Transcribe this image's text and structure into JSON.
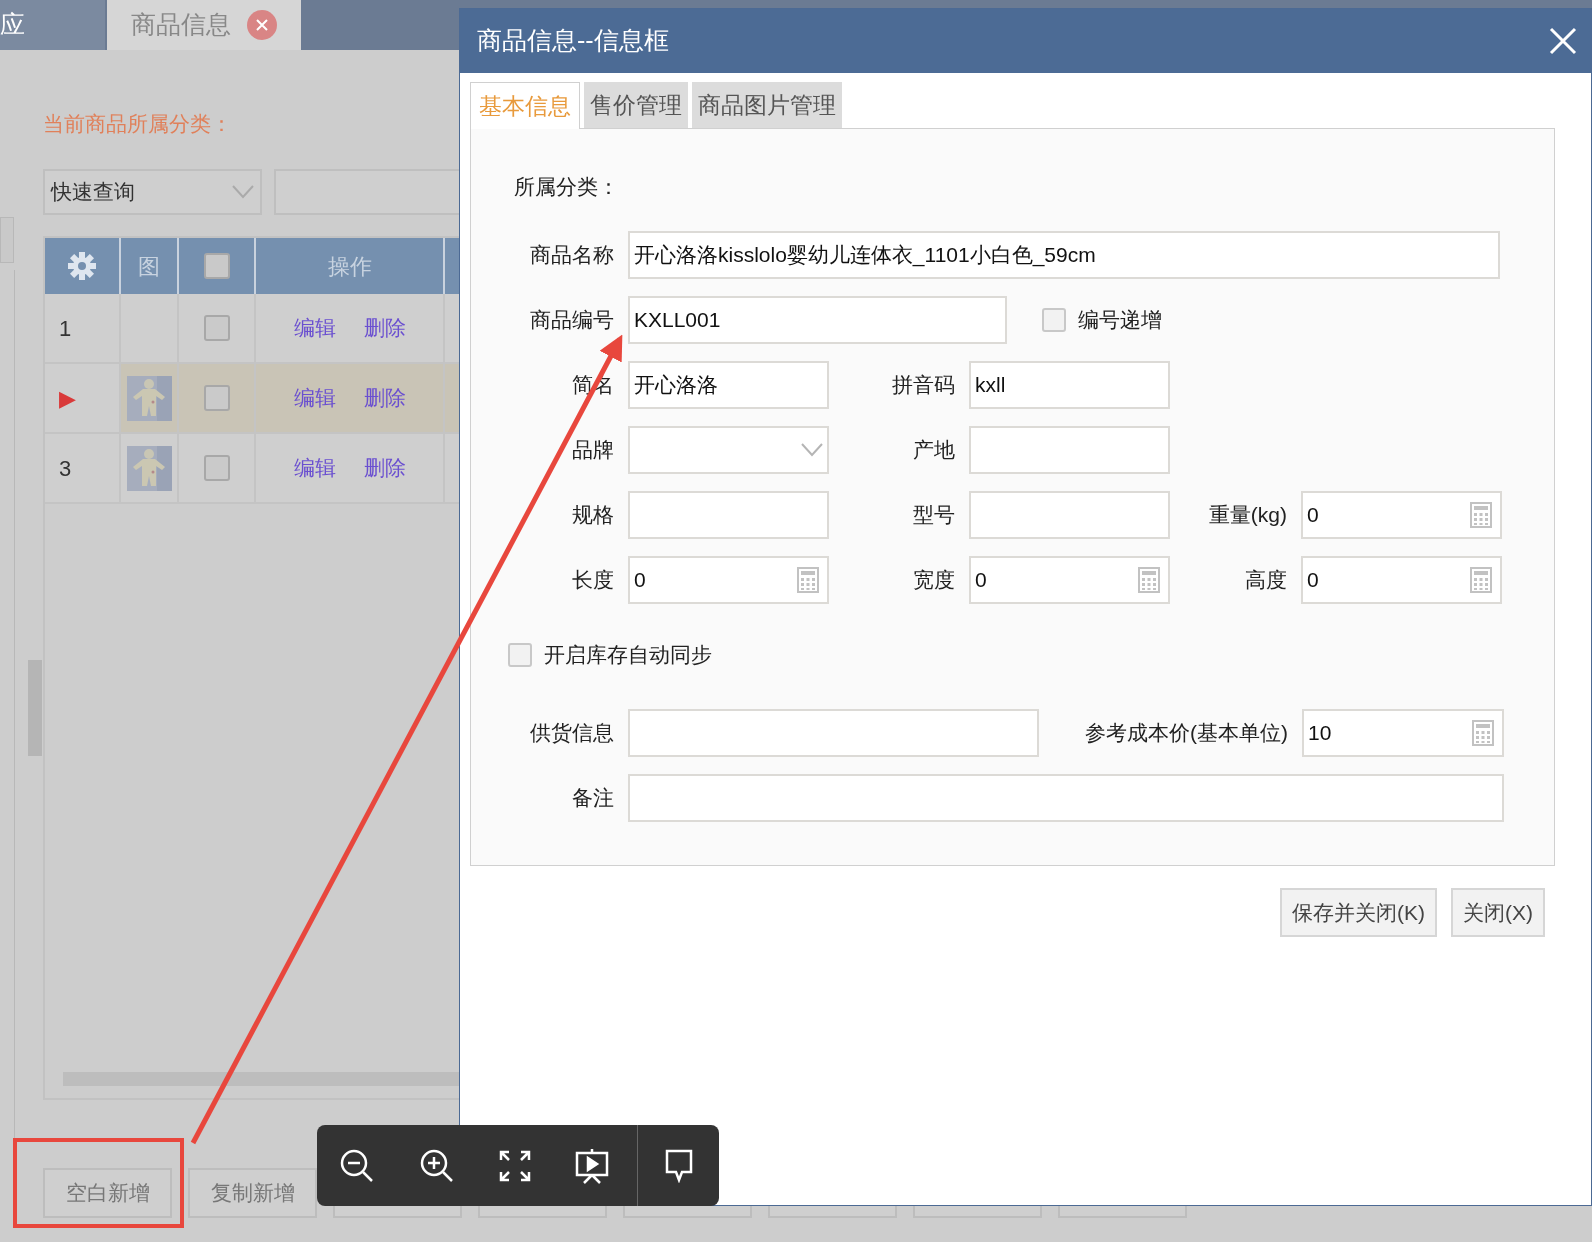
{
  "app_tabs": [
    {
      "label": "应",
      "selected": false,
      "closable": false
    },
    {
      "label": "商品信息",
      "selected": true,
      "closable": true
    }
  ],
  "category_label": "当前商品所属分类：",
  "quick_search": {
    "value": "快速查询"
  },
  "table": {
    "columns": [
      {
        "kind": "settings"
      },
      {
        "kind": "text",
        "label": "图"
      },
      {
        "kind": "checkbox",
        "checked": false
      },
      {
        "kind": "text",
        "label": "操作"
      }
    ],
    "rows": [
      {
        "marker": "1",
        "selected": false,
        "has_image": false,
        "checked": false,
        "actions": [
          "编辑",
          "删除"
        ]
      },
      {
        "marker": "▶",
        "selected": true,
        "has_image": true,
        "checked": false,
        "actions": [
          "编辑",
          "删除"
        ]
      },
      {
        "marker": "3",
        "selected": false,
        "has_image": true,
        "checked": false,
        "actions": [
          "编辑",
          "删除"
        ]
      }
    ]
  },
  "bottom_buttons": [
    "空白新增",
    "复制新增"
  ],
  "dialog": {
    "title": "商品信息--信息框",
    "tabs": [
      {
        "label": "基本信息",
        "selected": true
      },
      {
        "label": "售价管理",
        "selected": false
      },
      {
        "label": "商品图片管理",
        "selected": false
      }
    ],
    "category_label": "所属分类：",
    "rows": [
      [
        {
          "kind": "text",
          "label": "商品名称",
          "value": "开心洛洛kisslolo婴幼儿连体衣_1101小白色_59cm"
        }
      ],
      [
        {
          "kind": "text",
          "label": "商品编号",
          "value": "KXLL001"
        },
        {
          "kind": "checkbox",
          "label": "编号递增",
          "checked": false
        }
      ],
      [
        {
          "kind": "text",
          "label": "简名",
          "value": "开心洛洛"
        },
        {
          "kind": "text",
          "label": "拼音码",
          "value": "kxll"
        }
      ],
      [
        {
          "kind": "select",
          "label": "品牌"
        },
        {
          "kind": "text",
          "label": "产地"
        }
      ],
      [
        {
          "kind": "text",
          "label": "规格"
        },
        {
          "kind": "text",
          "label": "型号"
        },
        {
          "kind": "number",
          "label": "重量(kg)",
          "value": "0"
        }
      ],
      [
        {
          "kind": "number",
          "label": "长度",
          "value": "0"
        },
        {
          "kind": "number",
          "label": "宽度",
          "value": "0"
        },
        {
          "kind": "number",
          "label": "高度",
          "value": "0"
        }
      ],
      [
        {
          "kind": "checkbox",
          "label": "开启库存自动同步",
          "checked": false
        }
      ],
      [
        {
          "kind": "text",
          "label": "供货信息"
        },
        {
          "kind": "number",
          "label": "参考成本价(基本单位)",
          "value": "10"
        }
      ],
      [
        {
          "kind": "text",
          "label": "备注"
        }
      ]
    ],
    "buttons": [
      "保存并关闭(K)",
      "关闭(X)"
    ]
  }
}
